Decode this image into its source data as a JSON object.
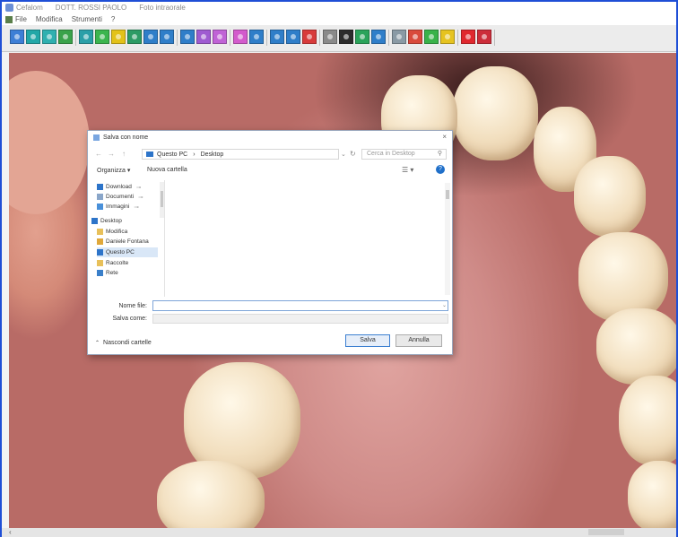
{
  "window": {
    "title_parts": [
      "Cefalom",
      "DOTT. ROSSI PAOLO",
      "Foto intraorale"
    ],
    "menu": [
      "File",
      "Modifica",
      "Strumenti",
      "?"
    ]
  },
  "toolbar": {
    "button_colors": [
      "#3d7fd6",
      "#22a7a7",
      "#2fb0b0",
      "#3aa24a",
      "#2b9fa8",
      "#3cb54e",
      "#e3c21a",
      "#2c9b65",
      "#2f7ec9",
      "#2f7ec9",
      "#2f7ec9",
      "#9f5bd1",
      "#c063d6",
      "#d35bcc",
      "#2f7ec9",
      "#2f7ec9",
      "#2f7ec9",
      "#d83b3b",
      "#8a8a8a",
      "#2c2c2c",
      "#2aa35a",
      "#2f7ec9",
      "#8a9aa5",
      "#d94a3c",
      "#39b24a",
      "#e6c320",
      "#e0282f",
      "#cc2d3a"
    ]
  },
  "dialog": {
    "title": "Salva con nome",
    "close_label": "×",
    "nav": {
      "back": "←",
      "forward": "→",
      "up": "↑"
    },
    "address": [
      "Questo PC",
      "Desktop"
    ],
    "search_placeholder": "Cerca in Desktop",
    "organize_label": "Organizza ▾",
    "new_folder_label": "Nuova cartella",
    "help_label": "?",
    "view_label": "☰ ▾",
    "nav_items": [
      {
        "label": "Download",
        "icon": "download-icon",
        "color": "#2d74c9",
        "pinned": true
      },
      {
        "label": "Documenti",
        "icon": "documents-icon",
        "color": "#8aa6c9",
        "pinned": true
      },
      {
        "label": "Immagini",
        "icon": "pictures-icon",
        "color": "#4a90d9",
        "pinned": true
      },
      {
        "label": "Desktop",
        "icon": "desktop-icon",
        "color": "#2d74c9",
        "pinned": false
      },
      {
        "label": "Modifica",
        "icon": "folder-icon",
        "color": "#e8c05a",
        "pinned": false
      },
      {
        "label": "Daniele Fontana",
        "icon": "user-folder-icon",
        "color": "#e0a83a",
        "pinned": false
      },
      {
        "label": "Questo PC",
        "icon": "pc-icon",
        "color": "#2d74c9",
        "pinned": false
      },
      {
        "label": "Raccolte",
        "icon": "libraries-icon",
        "color": "#e8c05a",
        "pinned": false
      },
      {
        "label": "Rete",
        "icon": "network-icon",
        "color": "#3a7fc9",
        "pinned": false
      }
    ],
    "file_name_label": "Nome file:",
    "file_name_value": "",
    "file_type_label": "Salva come:",
    "file_type_value": "",
    "hide_folders_label": "Nascondi cartelle",
    "save_label": "Salva",
    "cancel_label": "Annulla"
  },
  "status": {
    "left_arrow": "‹"
  }
}
